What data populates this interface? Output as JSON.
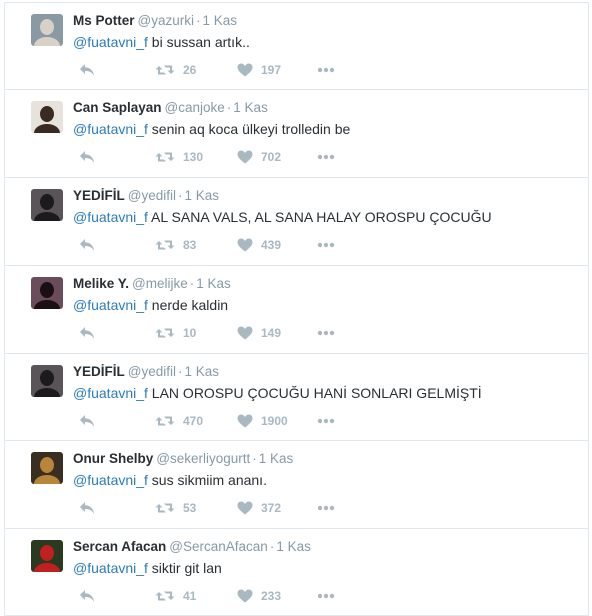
{
  "tweets": [
    {
      "name": "Ms Potter",
      "handle": "@yazurki",
      "time": "1 Kas",
      "mention": "@fuatavni_f",
      "text": " bi sussan artık..",
      "retweets": "26",
      "likes": "197",
      "avatar_bg": "#8a9aa4",
      "avatar_fg": "#d9d0c7"
    },
    {
      "name": "Can Saplayan",
      "handle": "@canjoke",
      "time": "1 Kas",
      "mention": "@fuatavni_f",
      "text": " senin aq koca ülkeyi trolledin be",
      "retweets": "130",
      "likes": "702",
      "avatar_bg": "#e8e2dc",
      "avatar_fg": "#3a2a22"
    },
    {
      "name": "YEDİFİL",
      "handle": "@yedifil",
      "time": "1 Kas",
      "mention": "@fuatavni_f",
      "text": " AL SANA VALS, AL SANA HALAY OROSPU ÇOCUĞU",
      "retweets": "83",
      "likes": "439",
      "avatar_bg": "#5a5458",
      "avatar_fg": "#1c1a1c"
    },
    {
      "name": "Melike Y.",
      "handle": "@melijke",
      "time": "1 Kas",
      "mention": "@fuatavni_f",
      "text": " nerde kaldin",
      "retweets": "10",
      "likes": "149",
      "avatar_bg": "#6a4c5a",
      "avatar_fg": "#1a1014"
    },
    {
      "name": "YEDİFİL",
      "handle": "@yedifil",
      "time": "1 Kas",
      "mention": "@fuatavni_f",
      "text": " LAN OROSPU ÇOCUĞU HANİ SONLARI GELMİŞTİ",
      "retweets": "470",
      "likes": "1900",
      "avatar_bg": "#5a5458",
      "avatar_fg": "#1c1a1c"
    },
    {
      "name": "Onur Shelby",
      "handle": "@sekerliyogurtt",
      "time": "1 Kas",
      "mention": "@fuatavni_f",
      "text": " sus sikmiim ananı.",
      "retweets": "53",
      "likes": "372",
      "avatar_bg": "#3a2e22",
      "avatar_fg": "#b8863a"
    },
    {
      "name": "Sercan Afacan",
      "handle": "@SercanAfacan",
      "time": "1 Kas",
      "mention": "@fuatavni_f",
      "text": " siktir git lan",
      "retweets": "41",
      "likes": "233",
      "avatar_bg": "#2a3a20",
      "avatar_fg": "#c02020"
    }
  ],
  "icons": {
    "reply": "reply-icon",
    "retweet": "retweet-icon",
    "like": "heart-icon",
    "more": "more-dots-icon"
  },
  "colors": {
    "mention": "#2b7bb9",
    "meta": "#8899a6",
    "action": "#aab8c2"
  }
}
